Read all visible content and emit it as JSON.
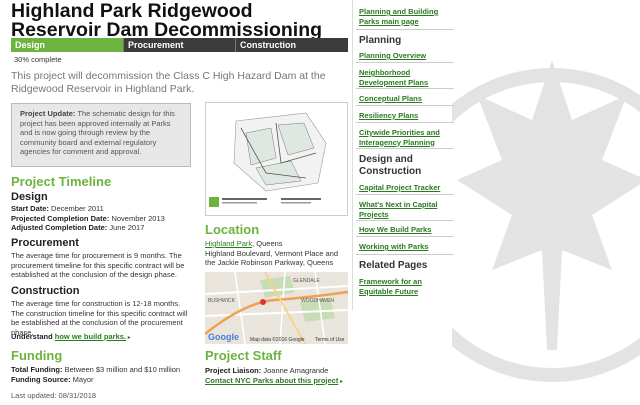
{
  "page": {
    "title": "Highland Park Ridgewood Reservoir Dam Decommissioning",
    "intro": "This project will decommission the Class C High Hazard Dam at the Ridgewood Reservoir in Highland Park.",
    "progress_text": "30% complete",
    "progress_value": 0.3,
    "update_label": "Project Update:",
    "update_text": " The schematic design for this project has been approved internally at Parks and is now going through review by the community board and external regulatory agencies for comment and approval.",
    "last_updated": "Last updated: 08/31/2018"
  },
  "tabs": [
    {
      "label": "Design",
      "active": true
    },
    {
      "label": "Procurement",
      "active": false
    },
    {
      "label": "Construction",
      "active": false
    }
  ],
  "timeline": {
    "heading": "Project Timeline",
    "design_heading": "Design",
    "start_label": "Start Date:",
    "start_value": " December 2011",
    "projected_label": "Projected Completion Date:",
    "projected_value": " November 2013",
    "adjusted_label": "Adjusted Completion Date:",
    "adjusted_value": " June 2017",
    "procurement_heading": "Procurement",
    "procurement_text": "The average time for procurement is 9 months. The procurement timeline for this specific contract will be established at the conclusion of the design phase.",
    "construction_heading": "Construction",
    "construction_text": "The average time for construction is 12-18 months. The construction timeline for this specific contract will be established at the conclusion of the procurement phase.",
    "understand_label": "Understand ",
    "understand_link": "how we build parks."
  },
  "funding": {
    "heading": "Funding",
    "total_label": "Total Funding:",
    "total_value": " Between $3 million and $10 million",
    "source_label": "Funding Source:",
    "source_value": " Mayor"
  },
  "location": {
    "heading": "Location",
    "park_link": "Highland Park",
    "borough": ", Queens",
    "address": "Highland Boulevard, Vermont Place and the Jackie Robinson Parkway, Queens"
  },
  "map": {
    "labels": [
      "GLENDALE",
      "BUSHWICK",
      "WOODHAVEN"
    ],
    "attribution": "Map data ©2016 Google",
    "terms": "Terms of Use",
    "google": "Google"
  },
  "staff": {
    "heading": "Project Staff",
    "liaison_label": "Project Liaison:",
    "liaison_value": " Joanne Amagrande",
    "contact_link": "Contact NYC Parks about this project"
  },
  "sidebar": {
    "top_link": "Planning and Building Parks main page",
    "planning_heading": "Planning",
    "planning_items": [
      "Planning Overview",
      "Neighborhood Development Plans",
      "Conceptual Plans",
      "Resiliency Plans",
      "Citywide Priorities and Interagency Planning"
    ],
    "design_heading": "Design and Construction",
    "design_items": [
      "Capital Project Tracker",
      "What's Next in Capital Projects",
      "How We Build Parks",
      "Working with Parks"
    ],
    "related_heading": "Related Pages",
    "related_items": [
      "Framework for an Equitable Future"
    ]
  },
  "colors": {
    "accent": "#6cb33f",
    "tab_bar": "#3b3b3b",
    "link": "#2a7a1f"
  }
}
